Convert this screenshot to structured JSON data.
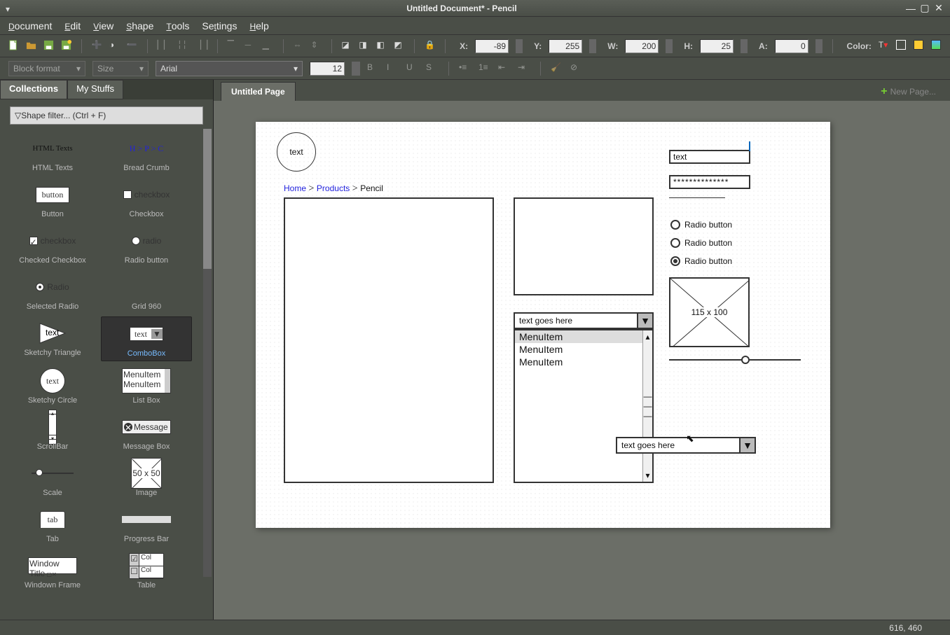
{
  "window": {
    "title": "Untitled Document* - Pencil"
  },
  "menu": [
    "Document",
    "Edit",
    "View",
    "Shape",
    "Tools",
    "Settings",
    "Help"
  ],
  "toolbar": {
    "x_label": "X:",
    "x": "-89",
    "y_label": "Y:",
    "y": "255",
    "w_label": "W:",
    "w": "200",
    "h_label": "H:",
    "h": "25",
    "a_label": "A:",
    "a": "0",
    "color_label": "Color:"
  },
  "format": {
    "block": "Block format",
    "size": "Size",
    "font": "Arial",
    "fontsize": "12"
  },
  "sidebar": {
    "tabs": [
      "Collections",
      "My Stuffs"
    ],
    "filter_placeholder": "Shape filter... (Ctrl + F)",
    "shapes": [
      {
        "cap": "HTML Texts",
        "raw": "HTML Texts"
      },
      {
        "cap": "Bread Crumb",
        "raw": "H > P > C"
      },
      {
        "cap": "Button",
        "raw": "button"
      },
      {
        "cap": "Checkbox",
        "raw": "checkbox"
      },
      {
        "cap": "Checked Checkbox",
        "raw": "checkbox"
      },
      {
        "cap": "Radio button",
        "raw": "radio"
      },
      {
        "cap": "Selected Radio",
        "raw": "Radio"
      },
      {
        "cap": "Grid 960"
      },
      {
        "cap": "Sketchy Triangle",
        "raw": "text"
      },
      {
        "cap": "ComboBox",
        "raw": "text"
      },
      {
        "cap": "Sketchy Circle",
        "raw": "text"
      },
      {
        "cap": "List Box",
        "raw": "MenuItem"
      },
      {
        "cap": "ScrollBar"
      },
      {
        "cap": "Message Box",
        "raw": "Message"
      },
      {
        "cap": "Scale"
      },
      {
        "cap": "Image",
        "raw": "50 x 50"
      },
      {
        "cap": "Tab",
        "raw": "tab"
      },
      {
        "cap": "Progress Bar"
      },
      {
        "cap": "Windown Frame",
        "raw": "Window Title"
      },
      {
        "cap": "Table",
        "raw": "Col"
      }
    ]
  },
  "page": {
    "tab": "Untitled Page",
    "newpage": "New Page...",
    "circle_text": "text",
    "breadcrumb": [
      "Home",
      "Products",
      "Pencil"
    ],
    "textfield": "text",
    "password": "**************",
    "radios": [
      "Radio button",
      "Radio button",
      "Radio button"
    ],
    "image_label": "115 x 100",
    "combo": "text goes here",
    "list_items": [
      "MenuItem",
      "MenuItem",
      "MenuItem"
    ],
    "combo2": "text goes here"
  },
  "status": {
    "coords": "616, 460"
  }
}
